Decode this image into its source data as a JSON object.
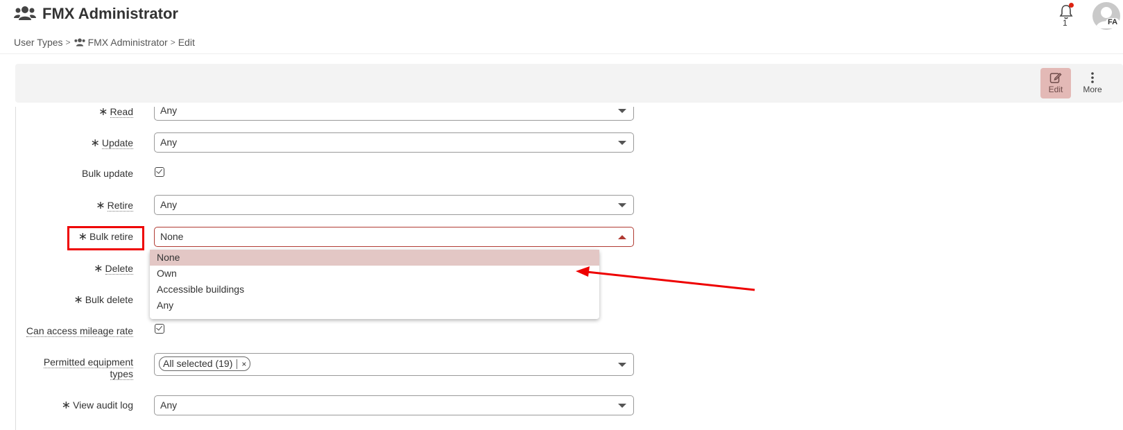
{
  "header": {
    "title": "FMX Administrator",
    "title_icon": "users-icon",
    "notification_count": "1",
    "avatar_initials": "FA"
  },
  "breadcrumb": {
    "items": [
      "User Types",
      "FMX Administrator",
      "Edit"
    ]
  },
  "toolbar": {
    "edit_label": "Edit",
    "more_label": "More"
  },
  "form": {
    "read": {
      "label": "Read",
      "value": "Any"
    },
    "update": {
      "label": "Update",
      "value": "Any"
    },
    "bulk_update": {
      "label": "Bulk update",
      "checked": true
    },
    "retire": {
      "label": "Retire",
      "value": "Any"
    },
    "bulk_retire": {
      "label": "Bulk retire",
      "value": "None"
    },
    "delete": {
      "label": "Delete"
    },
    "bulk_delete": {
      "label": "Bulk delete"
    },
    "mileage": {
      "label": "Can access mileage rate",
      "checked": true
    },
    "equipment": {
      "label_line1": "Permitted equipment",
      "label_line2": "types",
      "chip": "All selected (19)",
      "chip_remove": "×"
    },
    "audit": {
      "label": "View audit log",
      "value": "Any"
    },
    "required_marker": "∗"
  },
  "dropdown": {
    "options": [
      "None",
      "Own",
      "Accessible buildings",
      "Any"
    ],
    "selected": "None"
  },
  "colors": {
    "accent": "#b03a32",
    "selected_bg": "#e3c7c5",
    "annotation": "#ee0000"
  }
}
